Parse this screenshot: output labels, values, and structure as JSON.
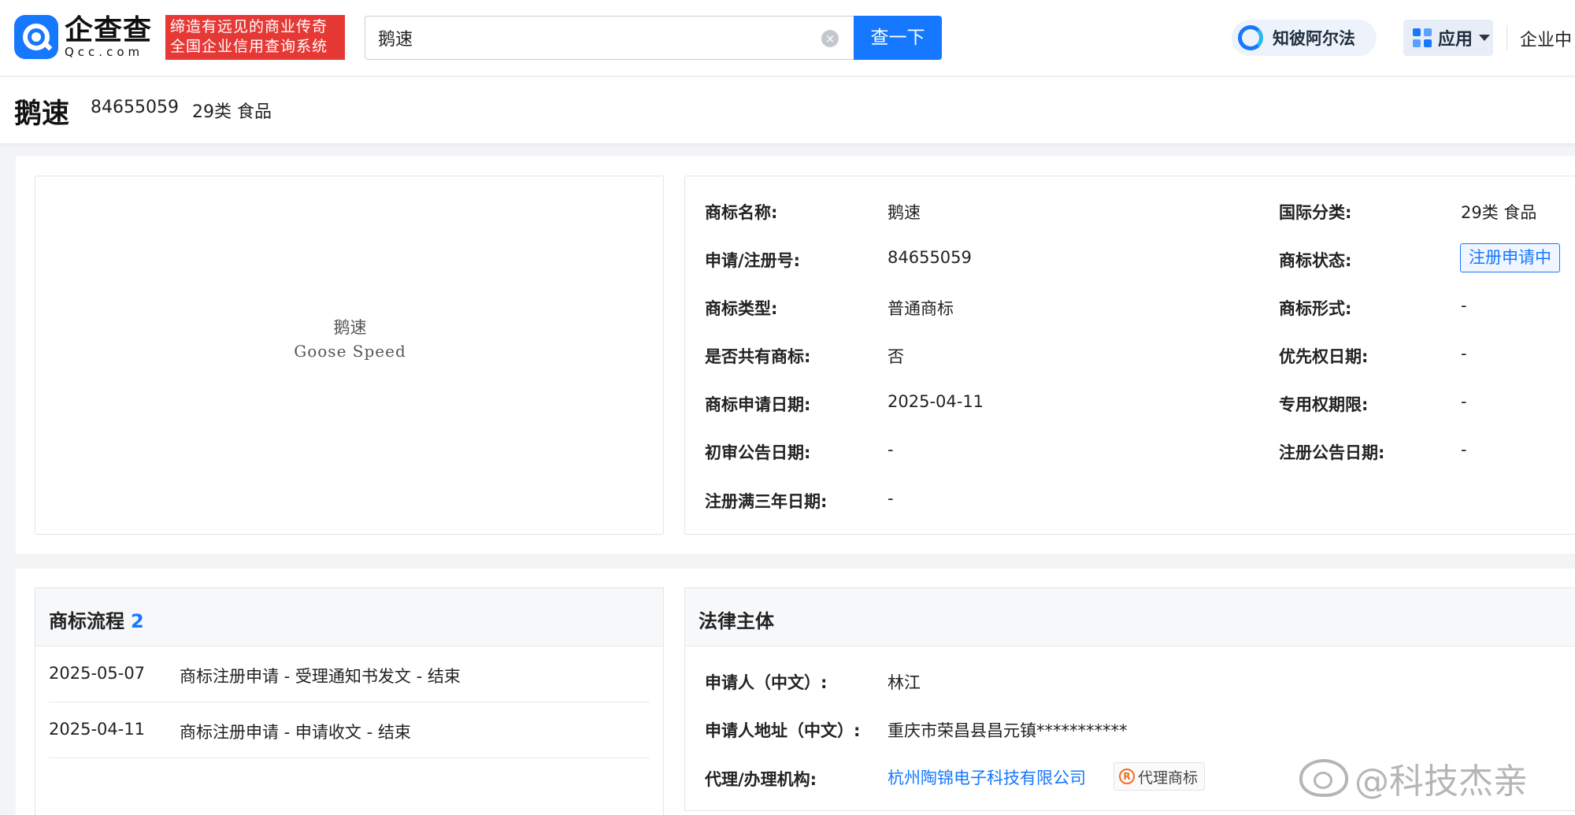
{
  "header": {
    "logo_cn": "企查查",
    "logo_en": "Qcc.com",
    "slogan_line1": "缔造有远见的商业传奇",
    "slogan_line2": "全国企业信用查询系统",
    "search_value": "鹅速",
    "search_button": "查一下",
    "zhibi_label": "知彼阿尔法",
    "apps_label": "应用",
    "enterprise_label": "企业中"
  },
  "title": {
    "name": "鹅速",
    "reg_number": "84655059",
    "class": "29类 食品"
  },
  "trademark_image": {
    "text_cn": "鹅速",
    "text_en": "Goose Speed"
  },
  "info": {
    "name_label": "商标名称:",
    "name_value": "鹅速",
    "regno_label": "申请/注册号:",
    "regno_value": "84655059",
    "type_label": "商标类型:",
    "type_value": "普通商标",
    "shared_label": "是否共有商标:",
    "shared_value": "否",
    "apply_date_label": "商标申请日期:",
    "apply_date_value": "2025-04-11",
    "prelim_label": "初审公告日期:",
    "prelim_value": "-",
    "three_year_label": "注册满三年日期:",
    "three_year_value": "-",
    "intl_class_label": "国际分类:",
    "intl_class_value": "29类 食品",
    "status_label": "商标状态:",
    "status_value": "注册申请中",
    "form_label": "商标形式:",
    "form_value": "-",
    "priority_label": "优先权日期:",
    "priority_value": "-",
    "exclusive_label": "专用权期限:",
    "exclusive_value": "-",
    "reg_notice_label": "注册公告日期:",
    "reg_notice_value": "-"
  },
  "flow": {
    "title": "商标流程",
    "count": "2",
    "rows": [
      {
        "date": "2025-05-07",
        "desc": "商标注册申请 - 受理通知书发文 - 结束"
      },
      {
        "date": "2025-04-11",
        "desc": "商标注册申请 - 申请收文 - 结束"
      }
    ]
  },
  "legal": {
    "title": "法律主体",
    "applicant_label": "申请人（中文）:",
    "applicant_value": "林江",
    "address_label": "申请人地址（中文）:",
    "address_value": "重庆市荣昌县昌元镇***********",
    "agent_label": "代理/办理机构:",
    "agent_value": "杭州陶锦电子科技有限公司",
    "agent_tag": "代理商标",
    "agent_tag_icon_text": "R"
  },
  "watermark": "@科技杰亲",
  "colors": {
    "brand_blue": "#1677ff",
    "slogan_red": "#e63936"
  }
}
